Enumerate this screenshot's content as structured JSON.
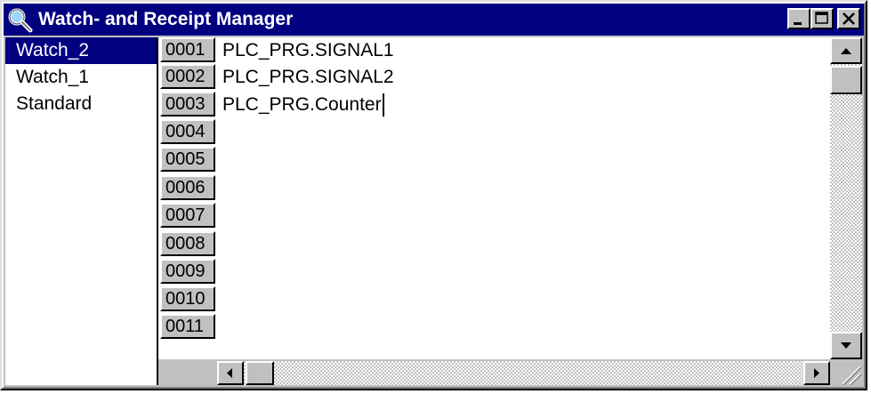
{
  "window": {
    "title": "Watch- and Receipt Manager",
    "icon": "magnifier-icon",
    "controls": [
      "minimize",
      "maximize",
      "close"
    ]
  },
  "watch_lists": {
    "selected": "Watch_2",
    "items": [
      {
        "label": "Watch_2"
      },
      {
        "label": "Watch_1"
      },
      {
        "label": "Standard"
      }
    ]
  },
  "editor": {
    "line_numbers": [
      "0001",
      "0002",
      "0003",
      "0004",
      "0005",
      "0006",
      "0007",
      "0008",
      "0009",
      "0010",
      "0011"
    ],
    "lines": [
      "PLC_PRG.SIGNAL1",
      "PLC_PRG.SIGNAL2",
      "PLC_PRG.Counter"
    ]
  },
  "colors": {
    "titlebar": "#000080",
    "selection": "#000080",
    "face": "#c0c0c0"
  }
}
